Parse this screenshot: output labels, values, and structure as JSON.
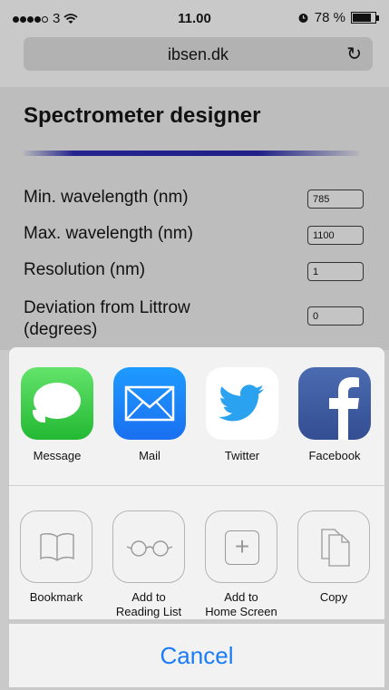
{
  "status_bar": {
    "carrier": "3",
    "time": "11.00",
    "battery": "78 %",
    "alarm_icon": "alarm-clock-icon",
    "wifi_icon": "wifi-icon"
  },
  "browser": {
    "url": "ibsen.dk",
    "reload_icon": "reload-icon"
  },
  "page": {
    "title": "Spectrometer designer",
    "fields": [
      {
        "label": "Min. wavelength (nm)",
        "value": "785"
      },
      {
        "label": "Max. wavelength (nm)",
        "value": "1100"
      },
      {
        "label": "Resolution (nm)",
        "value": "1"
      },
      {
        "label": "Deviation from Littrow (degrees)",
        "value": "0"
      }
    ]
  },
  "share_sheet": {
    "apps": [
      {
        "label": "Message",
        "icon": "message-icon"
      },
      {
        "label": "Mail",
        "icon": "mail-icon"
      },
      {
        "label": "Twitter",
        "icon": "twitter-icon"
      },
      {
        "label": "Facebook",
        "icon": "facebook-icon"
      }
    ],
    "actions": [
      {
        "label": "Bookmark",
        "icon": "bookmark-icon"
      },
      {
        "label": "Add to\nReading List",
        "icon": "reading-list-icon"
      },
      {
        "label": "Add to\nHome Screen",
        "icon": "add-home-screen-icon"
      },
      {
        "label": "Copy",
        "icon": "copy-icon"
      }
    ],
    "cancel": "Cancel"
  },
  "colors": {
    "accent": "#1a7cf5",
    "spectrum": "#24248f"
  }
}
